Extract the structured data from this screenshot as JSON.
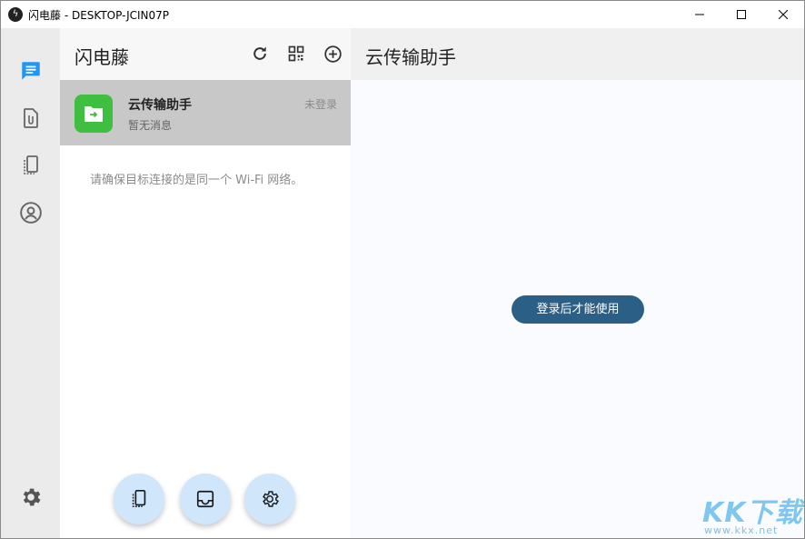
{
  "window": {
    "title": "闪电藤 - DESKTOP-JCIN07P"
  },
  "rail": {
    "items": [
      "chat-icon",
      "attachment-icon",
      "devices-icon",
      "account-icon"
    ],
    "settings": "gear-icon"
  },
  "list": {
    "title": "闪电藤",
    "header_icons": [
      "refresh-icon",
      "qr-code-icon",
      "add-circle-icon"
    ],
    "items": [
      {
        "name": "云传输助手",
        "subtitle": "暂无消息",
        "status": "未登录",
        "avatar_color": "#3fbf3f"
      }
    ],
    "hint": "请确保目标连接的是同一个 Wi-Fi 网络。",
    "fabs": [
      "devices-icon",
      "inbox-icon",
      "gear-icon"
    ]
  },
  "content": {
    "title": "云传输助手",
    "login_button": "登录后才能使用"
  },
  "watermark": {
    "logo": "KK下载",
    "url": "www.kkx.net"
  },
  "colors": {
    "accent_blue": "#2196f3",
    "login_button": "#2c5f86",
    "fab_bg": "#cfe6fb",
    "selected_item": "#c8c8c8"
  }
}
